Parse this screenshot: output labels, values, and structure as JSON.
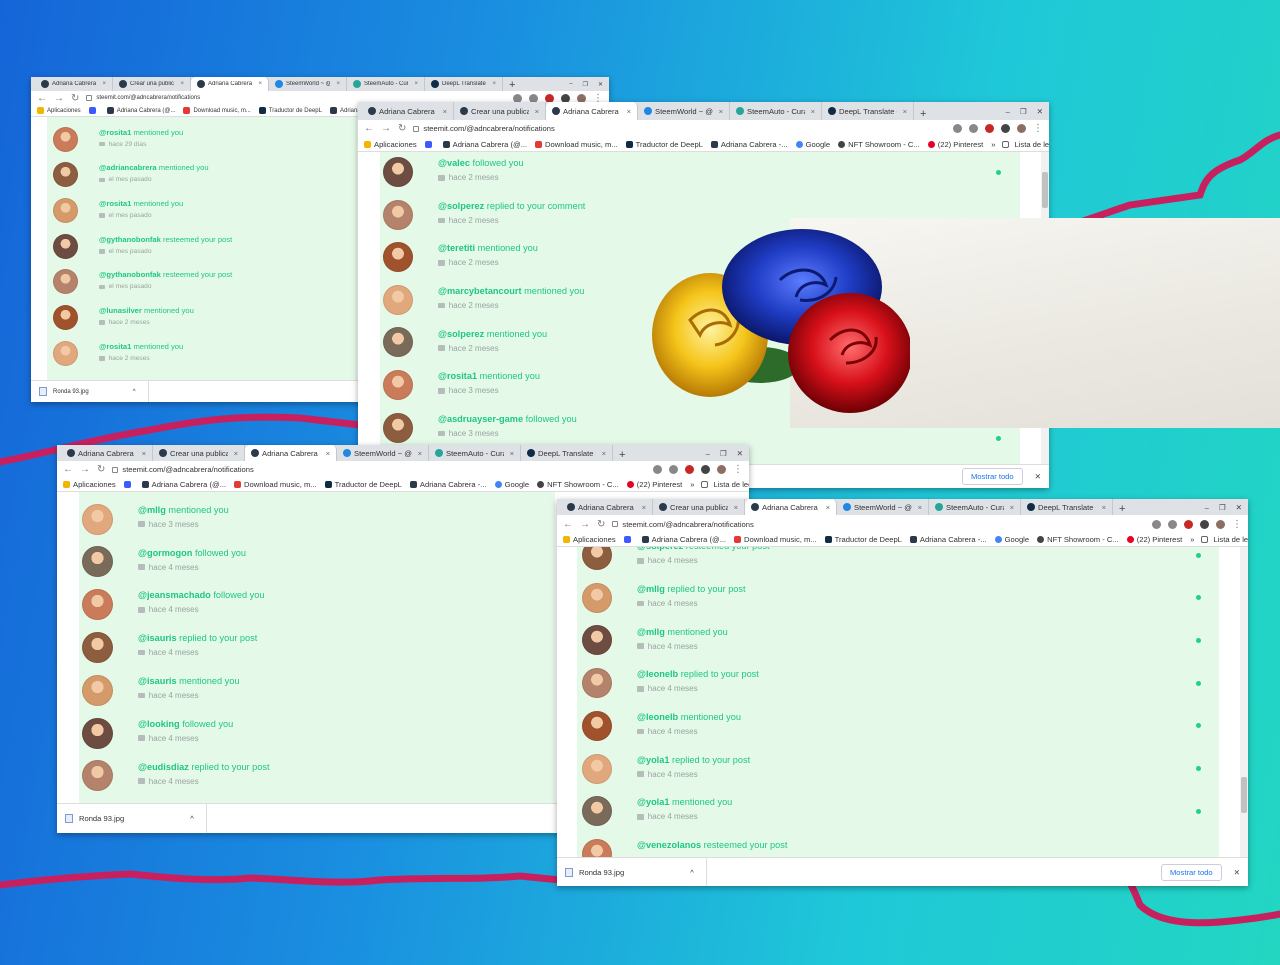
{
  "colors": {
    "accent_green": "#1fc783",
    "panel_bg": "#e4f9e8",
    "squiggle": "#c8205f"
  },
  "windows": [
    {
      "id": "w1",
      "tabs": [
        {
          "label": "Adriana Cabrera - @a",
          "favicon": "steemit-icon",
          "active": false
        },
        {
          "label": "Crear una publicació",
          "favicon": "steemit-icon",
          "active": false
        },
        {
          "label": "Adriana Cabrera (@a",
          "favicon": "steemit-icon",
          "active": true
        },
        {
          "label": "SteemWorld ~ @adn",
          "favicon": "steemworld-icon",
          "active": false
        },
        {
          "label": "SteemAuto - Curation",
          "favicon": "steemauto-icon",
          "active": false
        },
        {
          "label": "DeepL Translate - El m",
          "favicon": "deepl-icon",
          "active": false
        }
      ],
      "url": "steemit.com/@adncabrera/notifications",
      "bookmarks": [
        {
          "label": "Aplicaciones",
          "icon": "apps-grid-icon"
        },
        {
          "label": "",
          "icon": "extension-icon"
        },
        {
          "label": "Adriana Cabrera (@...",
          "icon": "steemit-icon"
        },
        {
          "label": "Download music, m...",
          "icon": "music-icon"
        },
        {
          "label": "Traductor de DeepL",
          "icon": "deepl-icon"
        },
        {
          "label": "Adriana Cabrera -...",
          "icon": "steemit-icon"
        }
      ],
      "notifications": [
        {
          "user": "@rosita1",
          "action": "mentioned you",
          "time": "hace 29 días",
          "type": "mention"
        },
        {
          "user": "@adriancabrera",
          "action": "mentioned you",
          "time": "el mes pasado",
          "type": "mention"
        },
        {
          "user": "@rosita1",
          "action": "mentioned you",
          "time": "el mes pasado",
          "type": "mention"
        },
        {
          "user": "@gythanobonfak",
          "action": "resteemed your post",
          "time": "el mes pasado",
          "type": "resteem"
        },
        {
          "user": "@gythanobonfak",
          "action": "resteemed your post",
          "time": "el mes pasado",
          "type": "resteem"
        },
        {
          "user": "@lunasilver",
          "action": "mentioned you",
          "time": "hace 2 meses",
          "type": "mention"
        },
        {
          "user": "@rosita1",
          "action": "mentioned you",
          "time": "hace 2 meses",
          "type": "mention"
        }
      ],
      "download": "Ronda 93.jpg"
    },
    {
      "id": "w2",
      "tabs": [
        {
          "label": "Adriana Cabrera - @a",
          "favicon": "steemit-icon",
          "active": false
        },
        {
          "label": "Crear una publicación",
          "favicon": "steemit-icon",
          "active": false
        },
        {
          "label": "Adriana Cabrera (@a",
          "favicon": "steemit-icon",
          "active": true
        },
        {
          "label": "SteemWorld ~ @adn",
          "favicon": "steemworld-icon",
          "active": false
        },
        {
          "label": "SteemAuto - Curation",
          "favicon": "steemauto-icon",
          "active": false
        },
        {
          "label": "DeepL Translate - El m",
          "favicon": "deepl-icon",
          "active": false
        }
      ],
      "url": "steemit.com/@adncabrera/notifications",
      "bookmarks": [
        {
          "label": "Aplicaciones",
          "icon": "apps-grid-icon"
        },
        {
          "label": "",
          "icon": "extension-icon"
        },
        {
          "label": "Adriana Cabrera (@...",
          "icon": "steemit-icon"
        },
        {
          "label": "Download music, m...",
          "icon": "music-icon"
        },
        {
          "label": "Traductor de DeepL",
          "icon": "deepl-icon"
        },
        {
          "label": "Adriana Cabrera -...",
          "icon": "steemit-icon"
        },
        {
          "label": "Google",
          "icon": "google-icon"
        },
        {
          "label": "NFT Showroom - C...",
          "icon": "nft-icon"
        },
        {
          "label": "(22) Pinterest",
          "icon": "pinterest-icon"
        }
      ],
      "reading_list": "Lista de lectura",
      "notifications": [
        {
          "user": "@valec",
          "action": "followed you",
          "time": "hace 2 meses",
          "type": "follow"
        },
        {
          "user": "@solperez",
          "action": "replied to your comment",
          "time": "hace 2 meses",
          "type": "reply"
        },
        {
          "user": "@teretiti",
          "action": "mentioned you",
          "time": "hace 2 meses",
          "type": "mention"
        },
        {
          "user": "@marcybetancourt",
          "action": "mentioned you",
          "time": "hace 2 meses",
          "type": "mention"
        },
        {
          "user": "@solperez",
          "action": "mentioned you",
          "time": "hace 2 meses",
          "type": "mention"
        },
        {
          "user": "@rosita1",
          "action": "mentioned you",
          "time": "hace 3 meses",
          "type": "mention"
        },
        {
          "user": "@asdruayser-game",
          "action": "followed you",
          "time": "hace 3 meses",
          "type": "follow"
        }
      ],
      "show_all": "Mostrar todo"
    },
    {
      "id": "w3",
      "tabs": [
        {
          "label": "Adriana Cabrera - @a",
          "favicon": "steemit-icon",
          "active": false
        },
        {
          "label": "Crear una publicación",
          "favicon": "steemit-icon",
          "active": false
        },
        {
          "label": "Adriana Cabrera (@a",
          "favicon": "steemit-icon",
          "active": true
        },
        {
          "label": "SteemWorld ~ @adn",
          "favicon": "steemworld-icon",
          "active": false
        },
        {
          "label": "SteemAuto - Curation",
          "favicon": "steemauto-icon",
          "active": false
        },
        {
          "label": "DeepL Translate - El m",
          "favicon": "deepl-icon",
          "active": false
        }
      ],
      "url": "steemit.com/@adncabrera/notifications",
      "bookmarks": [
        {
          "label": "Aplicaciones",
          "icon": "apps-grid-icon"
        },
        {
          "label": "",
          "icon": "extension-icon"
        },
        {
          "label": "Adriana Cabrera (@...",
          "icon": "steemit-icon"
        },
        {
          "label": "Download music, m...",
          "icon": "music-icon"
        },
        {
          "label": "Traductor de DeepL",
          "icon": "deepl-icon"
        },
        {
          "label": "Adriana Cabrera -...",
          "icon": "steemit-icon"
        },
        {
          "label": "Google",
          "icon": "google-icon"
        },
        {
          "label": "NFT Showroom - C...",
          "icon": "nft-icon"
        },
        {
          "label": "(22) Pinterest",
          "icon": "pinterest-icon"
        }
      ],
      "reading_list": "Lista de lectura",
      "notifications": [
        {
          "user": "@mllg",
          "action": "mentioned you",
          "time": "hace 3 meses",
          "type": "mention"
        },
        {
          "user": "@gormogon",
          "action": "followed you",
          "time": "hace 4 meses",
          "type": "follow"
        },
        {
          "user": "@jeansmachado",
          "action": "followed you",
          "time": "hace 4 meses",
          "type": "follow"
        },
        {
          "user": "@isauris",
          "action": "replied to your post",
          "time": "hace 4 meses",
          "type": "reply"
        },
        {
          "user": "@isauris",
          "action": "mentioned you",
          "time": "hace 4 meses",
          "type": "mention"
        },
        {
          "user": "@looking",
          "action": "followed you",
          "time": "hace 4 meses",
          "type": "follow"
        },
        {
          "user": "@eudisdiaz",
          "action": "replied to your post",
          "time": "hace 4 meses",
          "type": "reply"
        }
      ],
      "download": "Ronda 93.jpg"
    },
    {
      "id": "w4",
      "tabs": [
        {
          "label": "Adriana Cabrera - @a",
          "favicon": "steemit-icon",
          "active": false
        },
        {
          "label": "Crear una publicación",
          "favicon": "steemit-icon",
          "active": false
        },
        {
          "label": "Adriana Cabrera (@a",
          "favicon": "steemit-icon",
          "active": true
        },
        {
          "label": "SteemWorld ~ @adn",
          "favicon": "steemworld-icon",
          "active": false
        },
        {
          "label": "SteemAuto - Curation",
          "favicon": "steemauto-icon",
          "active": false
        },
        {
          "label": "DeepL Translate - El m",
          "favicon": "deepl-icon",
          "active": false
        }
      ],
      "url": "steemit.com/@adncabrera/notifications",
      "bookmarks": [
        {
          "label": "Aplicaciones",
          "icon": "apps-grid-icon"
        },
        {
          "label": "",
          "icon": "extension-icon"
        },
        {
          "label": "Adriana Cabrera (@...",
          "icon": "steemit-icon"
        },
        {
          "label": "Download music, m...",
          "icon": "music-icon"
        },
        {
          "label": "Traductor de DeepL",
          "icon": "deepl-icon"
        },
        {
          "label": "Adriana Cabrera -...",
          "icon": "steemit-icon"
        },
        {
          "label": "Google",
          "icon": "google-icon"
        },
        {
          "label": "NFT Showroom - C...",
          "icon": "nft-icon"
        },
        {
          "label": "(22) Pinterest",
          "icon": "pinterest-icon"
        }
      ],
      "reading_list": "Lista de lectura",
      "notifications": [
        {
          "user": "@solperez",
          "action": "resteemed your post",
          "time": "hace 4 meses",
          "type": "resteem"
        },
        {
          "user": "@mllg",
          "action": "replied to your post",
          "time": "hace 4 meses",
          "type": "reply"
        },
        {
          "user": "@mllg",
          "action": "mentioned you",
          "time": "hace 4 meses",
          "type": "mention"
        },
        {
          "user": "@leonelb",
          "action": "replied to your post",
          "time": "hace 4 meses",
          "type": "reply"
        },
        {
          "user": "@leonelb",
          "action": "mentioned you",
          "time": "hace 4 meses",
          "type": "mention"
        },
        {
          "user": "@yola1",
          "action": "replied to your post",
          "time": "hace 4 meses",
          "type": "reply"
        },
        {
          "user": "@yola1",
          "action": "mentioned you",
          "time": "hace 4 meses",
          "type": "mention"
        },
        {
          "user": "@venezolanos",
          "action": "resteemed your post",
          "time": "",
          "type": "resteem"
        }
      ],
      "download": "Ronda 93.jpg",
      "show_all": "Mostrar todo"
    }
  ]
}
